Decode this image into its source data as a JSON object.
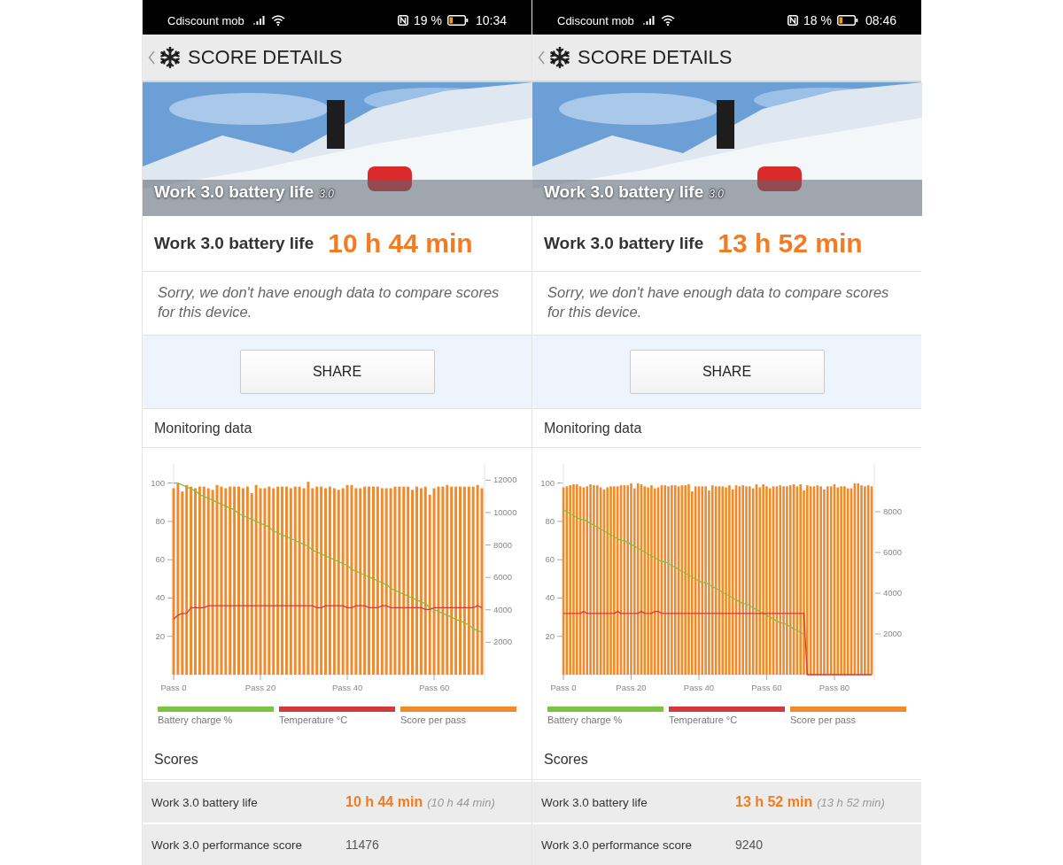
{
  "screens": [
    {
      "status_bar": {
        "carrier": "Cdiscount mob",
        "battery_percent": "19 %",
        "time": "10:34"
      },
      "header": {
        "title": "SCORE DETAILS"
      },
      "hero": {
        "title": "Work 3.0 battery life",
        "version": "3.0"
      },
      "result": {
        "label": "Work 3.0 battery life",
        "value": "10 h 44 min"
      },
      "note": "Sorry, we don't have enough data to compare scores for this device.",
      "share_button": "SHARE",
      "monitoring": {
        "title": "Monitoring data",
        "chart_data": {
          "type": "bar",
          "categories": [
            "Pass 0",
            null,
            null,
            null,
            null,
            null,
            null,
            null,
            null,
            null,
            null,
            null,
            null,
            null,
            null,
            null,
            null,
            null,
            null,
            null,
            "Pass 20",
            null,
            null,
            null,
            null,
            null,
            null,
            null,
            null,
            null,
            null,
            null,
            null,
            null,
            null,
            null,
            null,
            null,
            null,
            null,
            "Pass 40",
            null,
            null,
            null,
            null,
            null,
            null,
            null,
            null,
            null,
            null,
            null,
            null,
            null,
            null,
            null,
            null,
            null,
            null,
            null,
            "Pass 60",
            null,
            null,
            null,
            null,
            null,
            null,
            null,
            null,
            null,
            null,
            null
          ],
          "ylim": [
            0,
            110
          ],
          "y2lim": [
            0,
            13000
          ],
          "yticks": [
            20,
            40,
            60,
            80,
            100
          ],
          "y2ticks": [
            2000,
            4000,
            6000,
            8000,
            10000,
            12000
          ],
          "series": [
            {
              "name": "Battery charge %",
              "color": "#7dc243",
              "type": "line",
              "values": [
                100,
                100,
                99,
                98,
                97,
                96,
                94,
                93,
                92,
                91,
                90,
                89,
                88,
                87,
                86,
                84,
                83,
                82,
                81,
                80,
                79,
                78,
                77,
                75,
                74,
                73,
                72,
                71,
                70,
                69,
                68,
                67,
                65,
                64,
                63,
                62,
                61,
                60,
                59,
                58,
                57,
                55,
                54,
                53,
                52,
                51,
                50,
                49,
                48,
                47,
                45,
                44,
                43,
                42,
                41,
                40,
                39,
                38,
                37,
                35,
                34,
                33,
                32,
                31,
                30,
                29,
                28,
                27,
                26,
                24,
                23,
                22
              ]
            },
            {
              "name": "Temperature °C",
              "color": "#d23b3b",
              "type": "line",
              "values": [
                29,
                31,
                32,
                32,
                35,
                35,
                35,
                35,
                36,
                36,
                36,
                36,
                36,
                36,
                36,
                36,
                36,
                36,
                36,
                36,
                36,
                36,
                36,
                36,
                36,
                36,
                36,
                36,
                36,
                36,
                36,
                36,
                36,
                35,
                35,
                36,
                36,
                36,
                36,
                36,
                35,
                35,
                36,
                36,
                36,
                35,
                35,
                35,
                36,
                36,
                35,
                35,
                35,
                35,
                35,
                35,
                35,
                35,
                34,
                34,
                35,
                35,
                35,
                35,
                35,
                35,
                35,
                35,
                35,
                35,
                36,
                35
              ]
            },
            {
              "name": "Score per pass",
              "color": "#f08a2a",
              "type": "bar",
              "axis": "y2",
              "values": [
                11500,
                11800,
                11300,
                11700,
                11600,
                11500,
                11600,
                11600,
                11500,
                11400,
                11700,
                11600,
                11500,
                11600,
                11600,
                11600,
                11500,
                11600,
                11200,
                11700,
                11500,
                11500,
                11600,
                11500,
                11600,
                11600,
                11600,
                11500,
                11600,
                11600,
                11500,
                11900,
                11500,
                11600,
                11600,
                11500,
                11600,
                11500,
                11400,
                11500,
                11700,
                11700,
                11500,
                11500,
                11600,
                11600,
                11600,
                11600,
                11500,
                11500,
                11500,
                11600,
                11600,
                11600,
                11600,
                11400,
                11600,
                11500,
                11600,
                11100,
                11500,
                11600,
                11600,
                11700,
                11600,
                11600,
                11600,
                11600,
                11600,
                11600,
                11700,
                11500
              ]
            }
          ]
        }
      },
      "scores": {
        "title": "Scores",
        "rows": [
          {
            "kind": "time",
            "label": "Work 3.0 battery life",
            "value": "10 h 44 min",
            "detail": "(10 h 44 min)"
          },
          {
            "kind": "plain",
            "label": "Work 3.0 performance score",
            "value": "11476"
          }
        ]
      }
    },
    {
      "status_bar": {
        "carrier": "Cdiscount mob",
        "battery_percent": "18 %",
        "time": "08:46"
      },
      "header": {
        "title": "SCORE DETAILS"
      },
      "hero": {
        "title": "Work 3.0 battery life",
        "version": "3.0"
      },
      "result": {
        "label": "Work 3.0 battery life",
        "value": "13 h 52 min"
      },
      "note": "Sorry, we don't have enough data to compare scores for this device.",
      "share_button": "SHARE",
      "monitoring": {
        "title": "Monitoring data",
        "chart_data": {
          "type": "bar",
          "categories": [
            "Pass 0",
            null,
            null,
            null,
            null,
            null,
            null,
            null,
            null,
            null,
            null,
            null,
            null,
            null,
            null,
            null,
            null,
            null,
            null,
            null,
            "Pass 20",
            null,
            null,
            null,
            null,
            null,
            null,
            null,
            null,
            null,
            null,
            null,
            null,
            null,
            null,
            null,
            null,
            null,
            null,
            null,
            "Pass 40",
            null,
            null,
            null,
            null,
            null,
            null,
            null,
            null,
            null,
            null,
            null,
            null,
            null,
            null,
            null,
            null,
            null,
            null,
            null,
            "Pass 60",
            null,
            null,
            null,
            null,
            null,
            null,
            null,
            null,
            null,
            null,
            null,
            null,
            null,
            null,
            null,
            null,
            null,
            null,
            null,
            "Pass 80",
            null,
            null,
            null,
            null,
            null,
            null,
            null,
            null,
            null,
            null,
            null
          ],
          "ylim": [
            0,
            110
          ],
          "y2lim": [
            0,
            10350
          ],
          "yticks": [
            20,
            40,
            60,
            80,
            100
          ],
          "y2ticks": [
            2000,
            4000,
            6000,
            8000
          ],
          "series": [
            {
              "name": "Battery charge %",
              "color": "#7dc243",
              "type": "line",
              "values": [
                86,
                85,
                84,
                83,
                82,
                81,
                81,
                80,
                79,
                78,
                77,
                76,
                75,
                74,
                73,
                72,
                71,
                70,
                70,
                69,
                68,
                67,
                66,
                65,
                64,
                63,
                62,
                61,
                60,
                59,
                59,
                58,
                57,
                56,
                55,
                54,
                53,
                52,
                51,
                50,
                49,
                48,
                48,
                47,
                46,
                45,
                44,
                43,
                42,
                41,
                40,
                39,
                38,
                37,
                37,
                36,
                35,
                34,
                33,
                32,
                31,
                30,
                29,
                28,
                27,
                27,
                26,
                25,
                24,
                23,
                22,
                21,
                null,
                null,
                null,
                null,
                null,
                null,
                null,
                null,
                null,
                null,
                null,
                null,
                null,
                null,
                null,
                null,
                null,
                null,
                null,
                null
              ]
            },
            {
              "name": "Temperature °C",
              "color": "#d23b3b",
              "type": "line",
              "values": [
                32,
                32,
                32,
                32,
                32,
                32,
                33,
                32,
                32,
                32,
                32,
                32,
                32,
                32,
                32,
                32,
                33,
                32,
                32,
                32,
                32,
                32,
                32,
                33,
                32,
                32,
                32,
                33,
                33,
                32,
                32,
                32,
                32,
                32,
                32,
                32,
                32,
                32,
                32,
                32,
                32,
                32,
                32,
                32,
                32,
                32,
                32,
                32,
                32,
                32,
                32,
                32,
                32,
                32,
                32,
                32,
                32,
                32,
                32,
                32,
                32,
                32,
                32,
                32,
                32,
                32,
                32,
                32,
                32,
                32,
                32,
                32,
                0,
                0,
                0,
                0,
                0,
                0,
                0,
                0,
                0,
                0,
                0,
                0,
                0,
                0,
                0,
                0,
                0,
                0,
                0,
                0
              ]
            },
            {
              "name": "Score per pass",
              "color": "#f08a2a",
              "type": "bar",
              "axis": "y2",
              "values": [
                9200,
                9250,
                9300,
                9350,
                9350,
                9250,
                9200,
                9250,
                9350,
                9300,
                9300,
                9200,
                9100,
                9200,
                9250,
                9250,
                9250,
                9300,
                9300,
                9300,
                9400,
                9150,
                9400,
                9350,
                9250,
                9200,
                9300,
                9150,
                9200,
                9300,
                9300,
                9250,
                9300,
                9300,
                9250,
                9300,
                9300,
                9350,
                9000,
                9250,
                9250,
                9250,
                9250,
                9050,
                9300,
                9250,
                9250,
                9250,
                9200,
                9300,
                9100,
                9300,
                9250,
                9300,
                9250,
                9250,
                9150,
                9350,
                9200,
                9350,
                9250,
                9150,
                9250,
                9250,
                9300,
                9250,
                9250,
                9300,
                9350,
                9250,
                9350,
                9050,
                9300,
                9250,
                9250,
                9300,
                9250,
                9100,
                9250,
                9250,
                9350,
                9200,
                9250,
                9250,
                9150,
                9150,
                9400,
                9400,
                9300,
                9250,
                9300,
                9250
              ]
            }
          ]
        }
      },
      "scores": {
        "title": "Scores",
        "rows": [
          {
            "kind": "time",
            "label": "Work 3.0 battery life",
            "value": "13 h 52 min",
            "detail": "(13 h 52 min)"
          },
          {
            "kind": "plain",
            "label": "Work 3.0 performance score",
            "value": "9240"
          }
        ]
      }
    }
  ]
}
